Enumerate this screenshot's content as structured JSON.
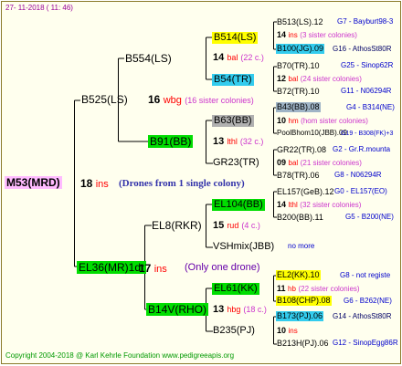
{
  "date": "27- 11-2018 ( 11: 46)",
  "footer": "Copyright 2004-2018 @ Karl Kehrle Foundation    www.pedigreeapis.org",
  "root": {
    "id": "M53(MRD)",
    "count": "18",
    "count_label": "ins",
    "note": "(Drones from 1 single colony)"
  },
  "g1_top": {
    "id": "B525(LS)"
  },
  "g1_bot": {
    "id": "EL36(MR)1dr",
    "count": "17",
    "count_label": "ins",
    "note": "(Only one drone)"
  },
  "g2": [
    {
      "id": "B554(LS)"
    },
    {
      "id": "16",
      "label": "wbg",
      "note": "(16 sister colonies)"
    },
    {
      "id": "B91(BB)"
    },
    {
      "id": "EL8(RKR)"
    },
    {
      "id": "B14V(RHO)"
    }
  ],
  "g3": [
    {
      "id": "B514(LS)"
    },
    {
      "count": "14",
      "label": "bal",
      "note": "(22 c.)"
    },
    {
      "id": "B54(TR)"
    },
    {
      "id": "B63(BB)"
    },
    {
      "count": "13",
      "label": "lthl",
      "note": "(32 c.)"
    },
    {
      "id": "GR23(TR)"
    },
    {
      "id": "EL104(BB)"
    },
    {
      "count": "15",
      "label": "rud",
      "note": "(4 c.)"
    },
    {
      "id": "VSHmix(JBB)"
    },
    {
      "id": "EL61(KK)"
    },
    {
      "count": "13",
      "label": "hbg",
      "note": "(18 c.)"
    },
    {
      "id": "B235(PJ)"
    }
  ],
  "g4": [
    {
      "id": "B513(LS).12",
      "info": "G7 - Bayburt98-3"
    },
    {
      "count": "14",
      "label": "ins",
      "note": "(3 sister colonies)"
    },
    {
      "id": "B100(JG).09",
      "info": "G16 - AthosSt80R"
    },
    {
      "id": "B70(TR).10",
      "info": "G25 - Sinop62R"
    },
    {
      "count": "12",
      "label": "bal",
      "note": "(24 sister colonies)"
    },
    {
      "id": "B72(TR).10",
      "info": "G11 - N06294R"
    },
    {
      "id": "B43(BB).08",
      "info": "G4 - B314(NE)"
    },
    {
      "count": "10",
      "label": "hm",
      "note": "(hom sister colonies)"
    },
    {
      "id": "PoolBhom10(JBB).09",
      "info": "G19 - B308(FK)+3"
    },
    {
      "id": "GR22(TR).08",
      "info": "G2 - Gr.R.mounta"
    },
    {
      "count": "09",
      "label": "bal",
      "note": "(21 sister colonies)"
    },
    {
      "id": "B78(TR).06",
      "info": "G8 - N06294R"
    },
    {
      "id": "EL157(GeB).12",
      "info": "G0 - EL157(EO)"
    },
    {
      "count": "14",
      "label": "lthl",
      "note": "(32 sister colonies)"
    },
    {
      "id": "B200(BB).11",
      "info": "G5 - B200(NE)"
    },
    {
      "id": "no more",
      "info": ""
    },
    {
      "id": "EL2(KK).10",
      "info": "G8 - not registe"
    },
    {
      "count": "11",
      "label": "hb",
      "note": "(22 sister colonies)"
    },
    {
      "id": "B108(CHP).08",
      "info": "G6 - B262(NE)"
    },
    {
      "id": "B173(PJ).06",
      "info": "G14 - AthosSt80R"
    },
    {
      "count": "10",
      "label": "ins",
      "note": ""
    },
    {
      "id": "B213H(PJ).06",
      "info": "G12 - SinopEgg86R"
    }
  ],
  "colors": {
    "border": "#8a7a2a",
    "background": "#ffffee",
    "line": "#000000"
  }
}
